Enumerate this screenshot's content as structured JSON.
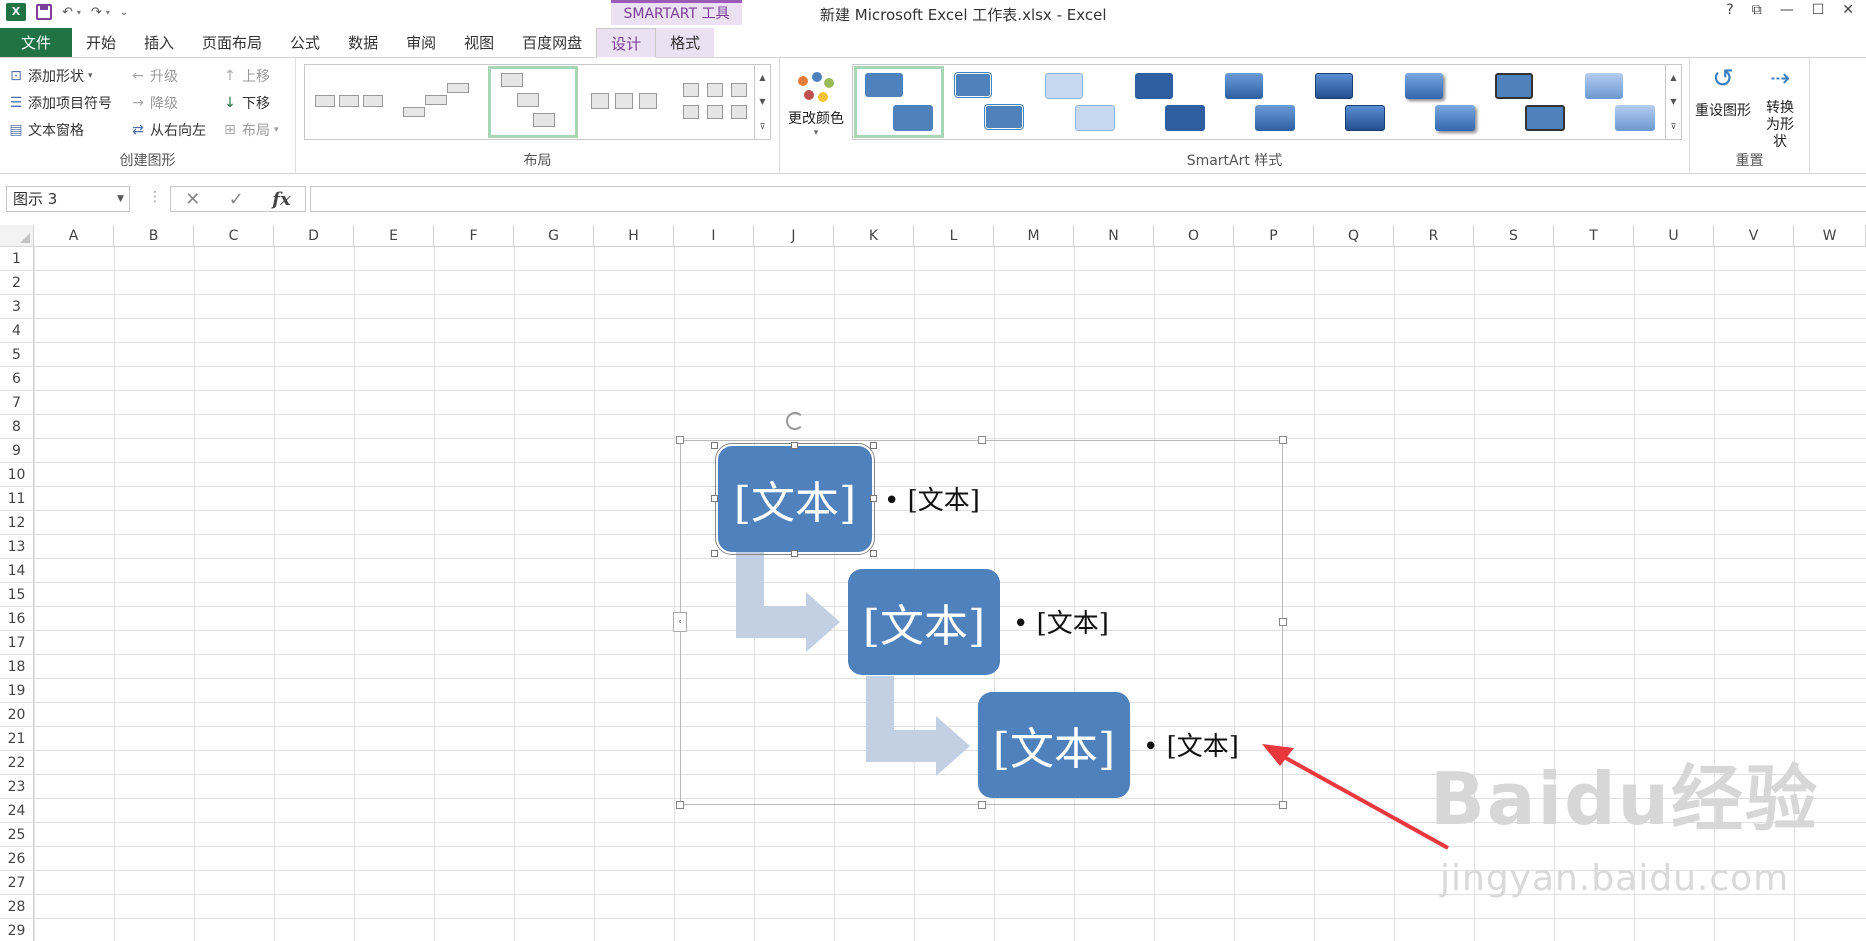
{
  "window": {
    "title": "新建 Microsoft Excel 工作表.xlsx - Excel",
    "context_tab": "SMARTART 工具",
    "help": "?",
    "controls": [
      "⧉",
      "—",
      "☐",
      "✕"
    ]
  },
  "tabs": [
    "文件",
    "开始",
    "插入",
    "页面布局",
    "公式",
    "数据",
    "审阅",
    "视图",
    "百度网盘",
    "设计",
    "格式"
  ],
  "ribbon": {
    "create": {
      "label": "创建图形",
      "add_shape": "添加形状",
      "add_bullet": "添加项目符号",
      "text_pane": "文本窗格",
      "promote": "升级",
      "demote": "降级",
      "rtl": "从右向左",
      "move_up": "上移",
      "move_down": "下移",
      "layout": "布局"
    },
    "layouts": {
      "label": "布局"
    },
    "styles": {
      "label": "SmartArt 样式",
      "change_colors": "更改颜色"
    },
    "reset": {
      "label": "重置",
      "reset_graphic": "重设图形",
      "convert": "转换为形状"
    }
  },
  "formula_bar": {
    "name_box": "图示 3",
    "cancel": "✕",
    "enter": "✓",
    "fx": "fx",
    "value": ""
  },
  "columns": [
    "A",
    "B",
    "C",
    "D",
    "E",
    "F",
    "G",
    "H",
    "I",
    "J",
    "K",
    "L",
    "M",
    "N",
    "O",
    "P",
    "Q",
    "R",
    "S",
    "T",
    "U",
    "V",
    "W"
  ],
  "rows": [
    "1",
    "2",
    "3",
    "4",
    "5",
    "6",
    "7",
    "8",
    "9",
    "10",
    "11",
    "12",
    "13",
    "14",
    "15",
    "16",
    "17",
    "18",
    "19",
    "20",
    "21",
    "22",
    "23",
    "24",
    "25",
    "26",
    "27",
    "28",
    "29"
  ],
  "smartart": {
    "nodes": [
      "[文本]",
      "[文本]",
      "[文本]"
    ],
    "bullets": [
      "[文本]",
      "[文本]",
      "[文本]"
    ],
    "node_color": "#4f81bd",
    "arrow_color": "#c3cfe2"
  },
  "annotation": {
    "arrow_color": "#e8383d"
  },
  "watermark": {
    "main": "Baidu经验",
    "sub": "jingyan.baidu.com"
  }
}
